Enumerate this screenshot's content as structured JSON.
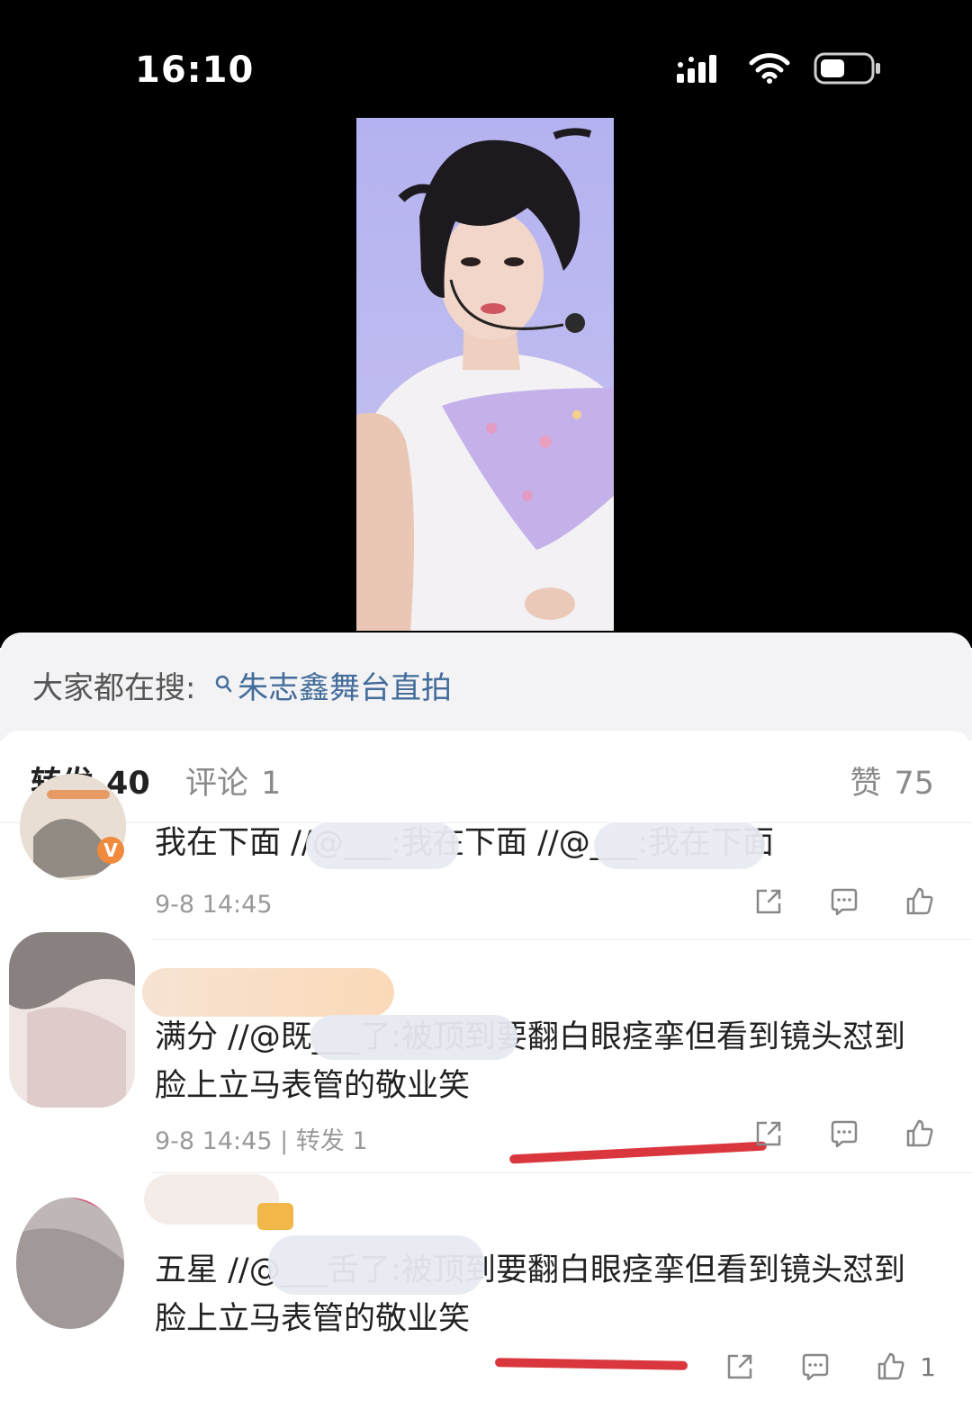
{
  "status": {
    "time": "16:10"
  },
  "search": {
    "prefix": "大家都在搜:",
    "query": "朱志鑫舞台直拍"
  },
  "tabs": {
    "repost_label": "转发",
    "repost_count": "40",
    "comment_label": "评论",
    "comment_count": "1",
    "like_label": "赞",
    "like_count": "75"
  },
  "items": [
    {
      "text": "我在下面 //@___:我在下面 //@___:我在下面",
      "time": "9-8 14:45",
      "like_count": ""
    },
    {
      "text": "满分 //@既___了:被顶到要翻白眼痉挛但看到镜头怼到脸上立马表管的敬业笑",
      "time": "9-8 14:45",
      "repost": "| 转发 1",
      "like_count": ""
    },
    {
      "text": "五星 //@___舌了:被顶到要翻白眼痉挛但看到镜头怼到脸上立马表管的敬业笑",
      "time": "",
      "like_count": "1"
    }
  ],
  "colors": {
    "accent_link": "#436c9b",
    "underline": "#d9363e"
  }
}
